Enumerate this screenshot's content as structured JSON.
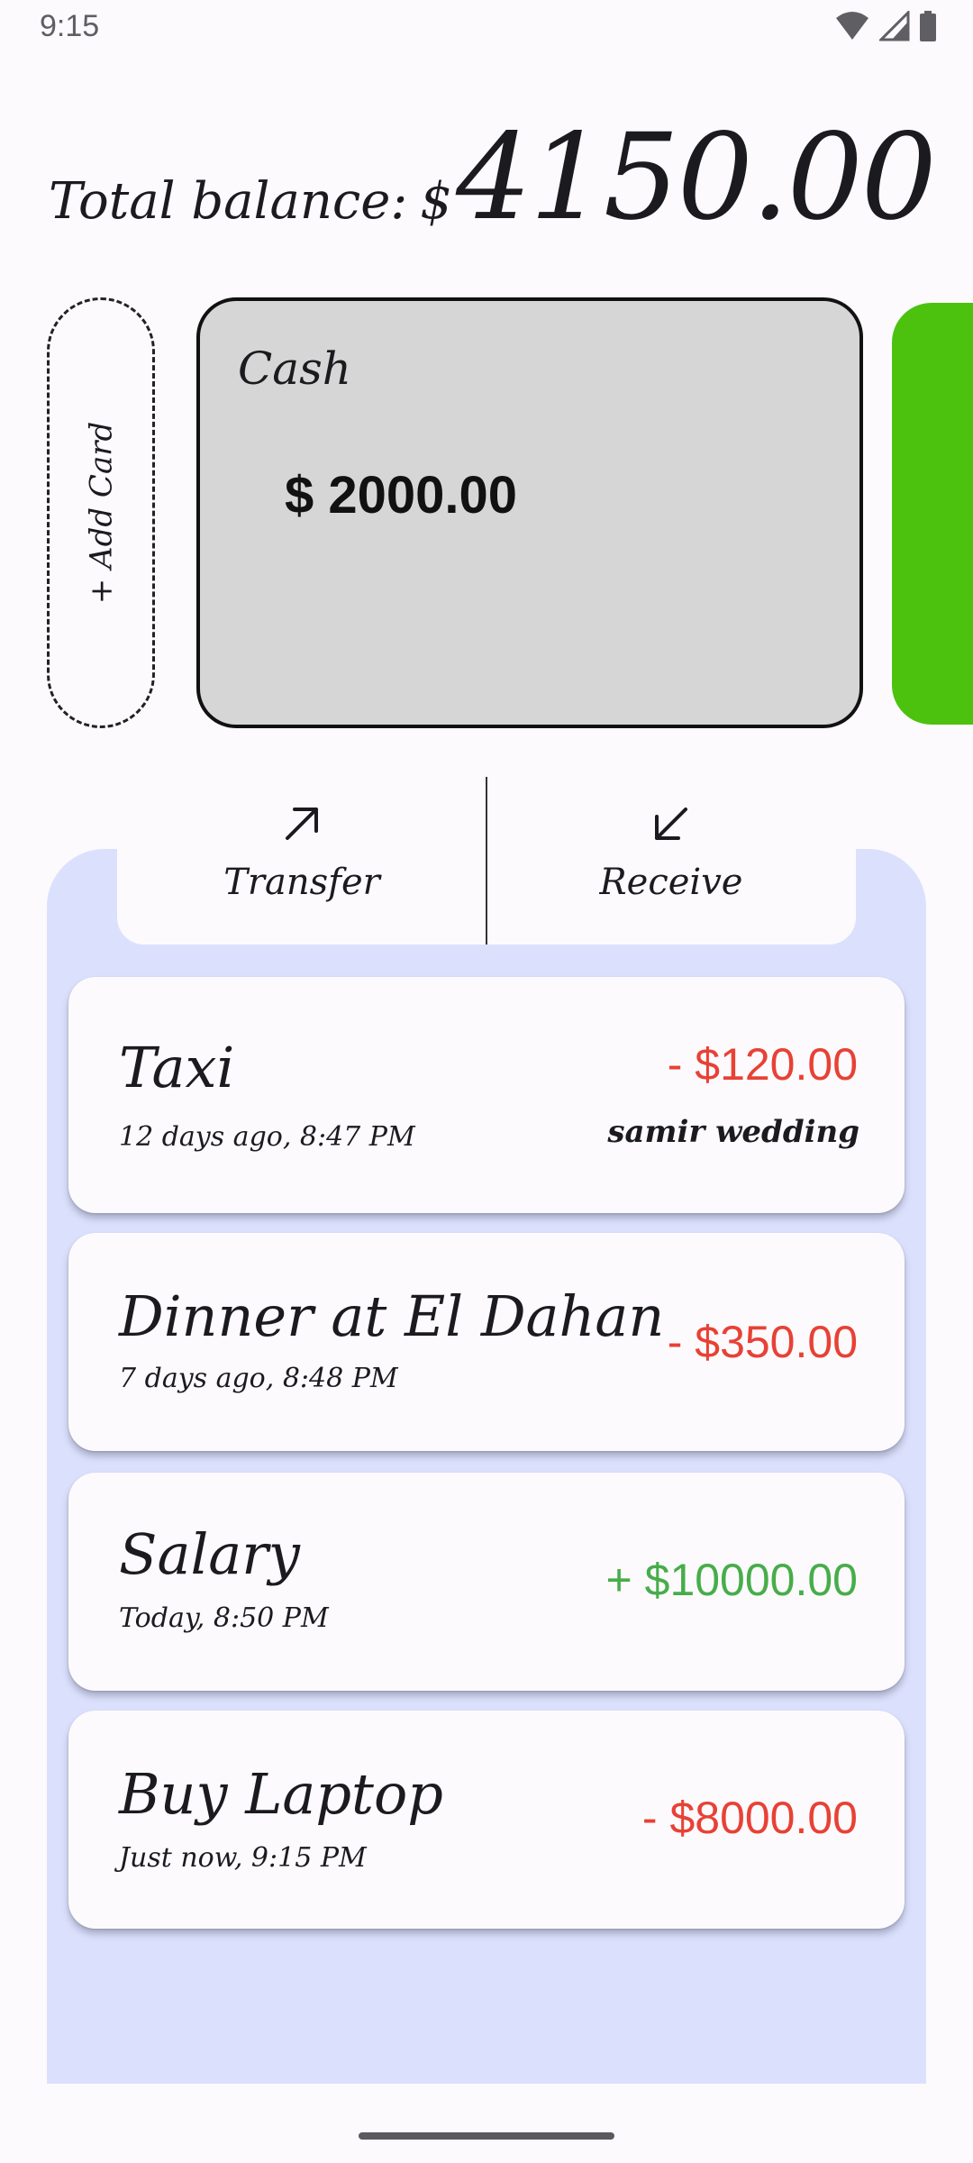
{
  "status_bar": {
    "time": "9:15",
    "icons": [
      "wifi-icon",
      "cellular-signal-icon",
      "battery-icon"
    ]
  },
  "balance": {
    "label": "Total balance:",
    "currency": "$",
    "amount": "4150.00"
  },
  "wallets": {
    "add_card_label": "+ Add Card",
    "current": {
      "name": "Cash",
      "amount": "$ 2000.00",
      "color": "#d6d6d6"
    },
    "next_card_color": "#4cc20f"
  },
  "actions": {
    "transfer": {
      "label": "Transfer",
      "icon": "arrow-up-right-icon"
    },
    "receive": {
      "label": "Receive",
      "icon": "arrow-down-left-icon"
    }
  },
  "transactions": [
    {
      "title": "Taxi",
      "time": "12 days ago, 8:47 PM",
      "amount": "- $120.00",
      "note": "samir wedding",
      "type": "expense"
    },
    {
      "title": "Dinner at El Dahan",
      "time": "7 days ago, 8:48 PM",
      "amount": "- $350.00",
      "note": "",
      "type": "expense"
    },
    {
      "title": "Salary",
      "time": "Today, 8:50 PM",
      "amount": "+ $10000.00",
      "note": "",
      "type": "income"
    },
    {
      "title": "Buy Laptop",
      "time": "Just now, 9:15 PM",
      "amount": "- $8000.00",
      "note": "",
      "type": "expense"
    }
  ],
  "colors": {
    "background": "#fcfafd",
    "panel": "#dbe1fd",
    "expense": "#e84135",
    "income": "#47ad4a"
  }
}
